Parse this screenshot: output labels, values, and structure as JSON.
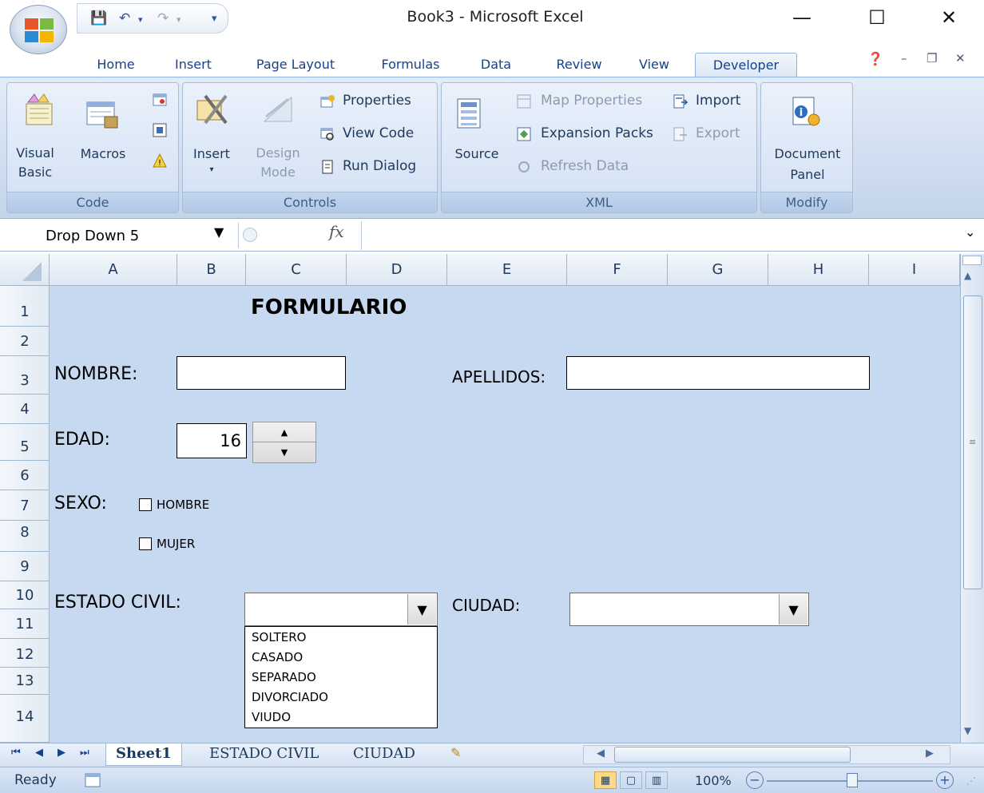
{
  "window": {
    "title": "Book3 - Microsoft Excel",
    "minimize_glyph": "—",
    "maximize_glyph": "☐",
    "close_glyph": "✕"
  },
  "ribbon": {
    "tabs": [
      "Home",
      "Insert",
      "Page Layout",
      "Formulas",
      "Data",
      "Review",
      "View",
      "Developer"
    ],
    "active_tab": "Developer",
    "groups": {
      "code": {
        "label": "Code",
        "visual_basic": "Visual\nBasic",
        "visual_basic_l1": "Visual",
        "visual_basic_l2": "Basic",
        "macros": "Macros"
      },
      "controls": {
        "label": "Controls",
        "insert": "Insert",
        "design_mode_l1": "Design",
        "design_mode_l2": "Mode",
        "properties": "Properties",
        "view_code": "View Code",
        "run_dialog": "Run Dialog"
      },
      "xml": {
        "label": "XML",
        "source": "Source",
        "map_properties": "Map Properties",
        "expansion_packs": "Expansion Packs",
        "refresh_data": "Refresh Data",
        "import": "Import",
        "export": "Export"
      },
      "modify": {
        "label": "Modify",
        "document_panel_l1": "Document",
        "document_panel_l2": "Panel"
      }
    }
  },
  "formula_bar": {
    "name_box": "Drop Down 5",
    "fx": "fx",
    "formula": ""
  },
  "grid": {
    "columns": [
      "A",
      "B",
      "C",
      "D",
      "E",
      "F",
      "G",
      "H",
      "I"
    ],
    "rows": [
      "1",
      "2",
      "3",
      "4",
      "5",
      "6",
      "7",
      "8",
      "9",
      "10",
      "11",
      "12",
      "13",
      "14"
    ]
  },
  "form": {
    "title": "FORMULARIO",
    "nombre_label": "NOMBRE:",
    "nombre_value": "",
    "apellidos_label": "APELLIDOS:",
    "apellidos_value": "",
    "edad_label": "EDAD:",
    "edad_value": "16",
    "sexo_label": "SEXO:",
    "sexo_options": [
      "HOMBRE",
      "MUJER"
    ],
    "estado_civil_label": "ESTADO CIVIL:",
    "estado_civil_value": "",
    "estado_civil_options": [
      "SOLTERO",
      "CASADO",
      "SEPARADO",
      "DIVORCIADO",
      "VIUDO"
    ],
    "ciudad_label": "CIUDAD:",
    "ciudad_value": ""
  },
  "sheet_tabs": [
    "Sheet1",
    "ESTADO CIVIL",
    "CIUDAD"
  ],
  "active_sheet": "Sheet1",
  "status_bar": {
    "status": "Ready",
    "zoom": "100%"
  },
  "colors": {
    "ribbon_bg": "#d0def1",
    "grid_bg": "#c7d9f0",
    "accent": "#15428b"
  }
}
